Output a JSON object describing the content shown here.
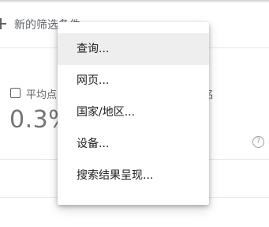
{
  "filter_bar": {
    "new_filter_label": "新的筛选条件"
  },
  "metric": {
    "label": "平均点",
    "value": "0.3%",
    "right_label": "名",
    "help_symbol": "?"
  },
  "menu": {
    "items": [
      {
        "label": "查询...",
        "active": true
      },
      {
        "label": "网页..."
      },
      {
        "label": "国家/地区..."
      },
      {
        "label": "设备..."
      },
      {
        "label": "搜索结果呈现..."
      }
    ]
  },
  "icons": {
    "add": "plus-icon",
    "help": "help-icon",
    "checkbox": "checkbox"
  }
}
